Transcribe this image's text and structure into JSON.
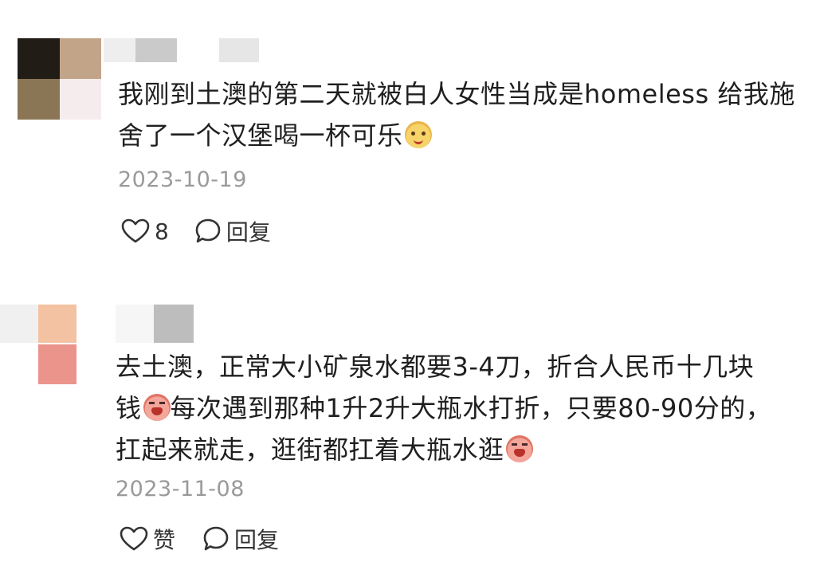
{
  "comments": [
    {
      "text": "我刚到土澳的第二天就被白人女性当成是homeless 给我施舍了一个汉堡喝一杯可乐",
      "date": "2023-10-19",
      "like_label": "8",
      "reply_label": "回复",
      "emoji": "smiling-fruit-emoji",
      "avatar_colors": [
        "#211d16",
        "#c2a489",
        "#8a7555",
        "#f5eded"
      ],
      "username_mosaic_colors": [
        "#e3e3e3",
        "#cacaca",
        "#e6e6e6"
      ]
    },
    {
      "text_parts": [
        "去土澳，正常大小矿泉水都要3-4刀，折合人民币十几块钱",
        "每次遇到那种1升2升大瓶水打折，只要80-90分的，扛起来就走，逛街都扛着大瓶水逛"
      ],
      "date": "2023-11-08",
      "like_label": "赞",
      "reply_label": "回复",
      "emoji": "crying-face-emoji",
      "avatar_colors": [
        "#f0f0f0",
        "#f3c2a2",
        "#eb948b"
      ],
      "username_mosaic_colors": [
        "#f2f2f2",
        "#bdbdbd"
      ]
    }
  ],
  "icons": {
    "like": "heart-icon",
    "reply": "speech-bubble-icon"
  }
}
